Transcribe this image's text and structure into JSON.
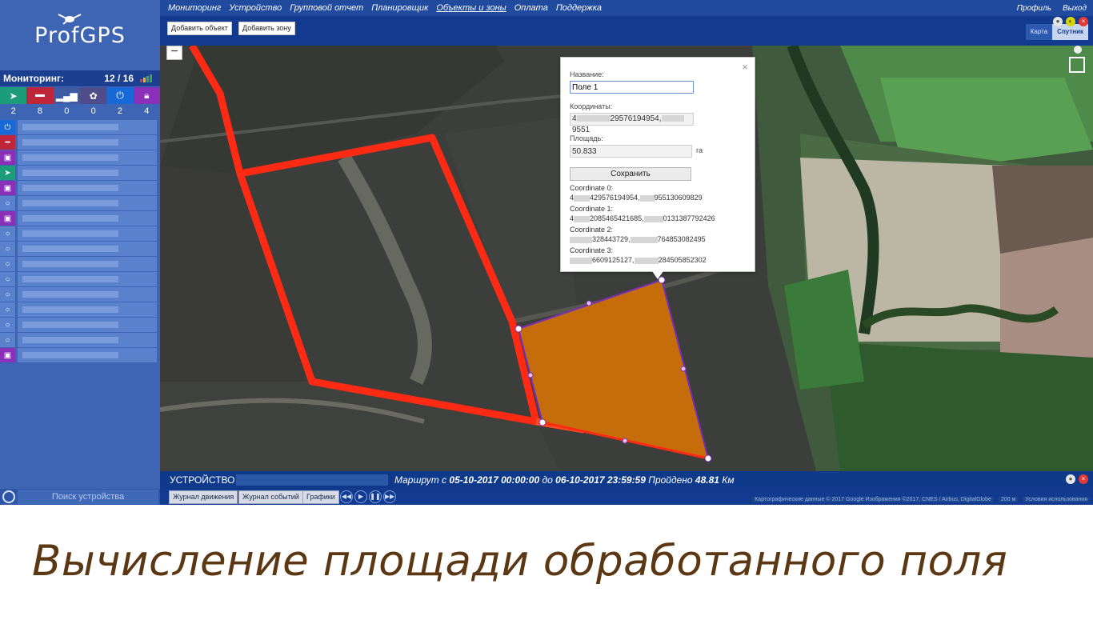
{
  "app": {
    "logo_text": "ProfGPS"
  },
  "monitoring": {
    "label": "Мониторинг:",
    "count": "12 / 16",
    "status_counts": [
      "2",
      "8",
      "0",
      "0",
      "2",
      "4"
    ]
  },
  "device_search": {
    "placeholder": "Поиск устройства"
  },
  "nav": {
    "items": [
      "Мониторинг",
      "Устройство",
      "Групповой отчет",
      "Планировщик",
      "Объекты и зоны",
      "Оплата",
      "Поддержка"
    ],
    "active_index": 4,
    "profile": "Профиль",
    "logout": "Выход"
  },
  "toolbar": {
    "add_object": "Добавить объект",
    "add_zone": "Добавить зону",
    "map_type_map": "Карта",
    "map_type_satellite": "Спутник"
  },
  "map": {
    "zoom_label": "−"
  },
  "popup": {
    "name_label": "Название:",
    "name_value": "Поле 1",
    "coords_label": "Координаты:",
    "coords_value": "4",
    "coords_value_tail": "29576194954,",
    "coords_value_end": "9551",
    "area_label": "Площадь:",
    "area_value": "50.833",
    "area_unit": "га",
    "save_button": "Сохранить",
    "coordinates": [
      {
        "label": "Coordinate 0:",
        "head": "4",
        "mid": "429576194954,",
        "tail": "955130609829"
      },
      {
        "label": "Coordinate 1:",
        "head": "4",
        "mid": "2085465421685,",
        "tail": "0131387792426"
      },
      {
        "label": "Coordinate 2:",
        "head": "",
        "mid": "328443729,",
        "tail": "764853082495"
      },
      {
        "label": "Coordinate 3:",
        "head": "",
        "mid": "6609125127,",
        "tail": "284505852302"
      }
    ]
  },
  "statusbar": {
    "device_label": "УСТРОЙСТВО",
    "route_prefix": "Маршрут с",
    "date_from": "05-10-2017 00:00:00",
    "to_word": "до",
    "date_to": "06-10-2017 23:59:59",
    "passed_word": "Пройдено",
    "distance": "48.81",
    "distance_unit": "Км"
  },
  "bottom_tabs": {
    "movement_log": "Журнал движения",
    "events_log": "Журнал событий",
    "charts": "Графики"
  },
  "attribution": {
    "map_data": "Картографические данные © 2017 Google Изображения ©2017, CNES / Airbus, DigitalGlobe",
    "scale": "200 м",
    "terms": "Условия использования"
  },
  "caption": {
    "text": "Вычисление площади обработанного поля"
  },
  "colors": {
    "sidebar_bg": "#3e64b4",
    "nav_bg": "#1f4a9e",
    "track_red": "#ff2a14",
    "field_fill": "#c56d0a",
    "field_stroke": "#7b2fb8",
    "caption_color": "#5b3713"
  }
}
